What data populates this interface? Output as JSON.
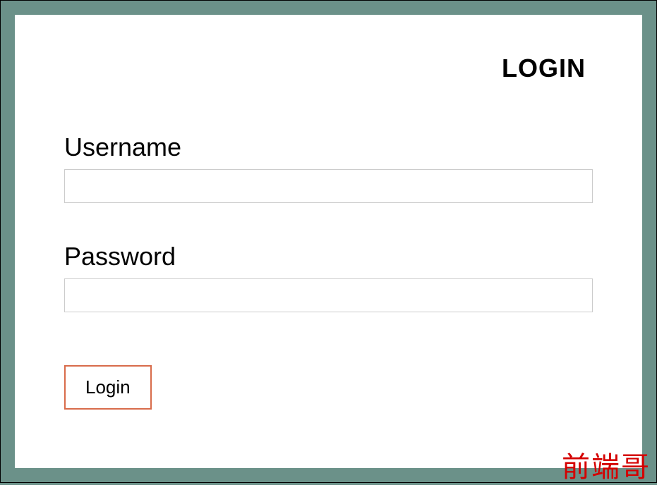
{
  "header": {
    "title": "LOGIN"
  },
  "form": {
    "username": {
      "label": "Username",
      "value": "",
      "placeholder": ""
    },
    "password": {
      "label": "Password",
      "value": "",
      "placeholder": ""
    },
    "submit": {
      "label": "Login"
    }
  },
  "watermark": {
    "text": "前端哥"
  }
}
